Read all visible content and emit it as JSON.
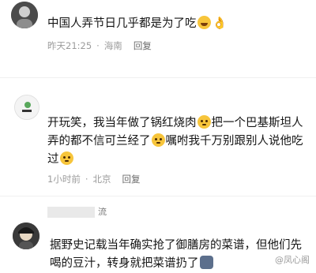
{
  "comments": [
    {
      "text": "中国人弄节日几乎都是为了吃",
      "emojis": [
        "laughing-crying",
        "ok-hand"
      ],
      "time": "昨天21:25",
      "location": "海南",
      "reply_label": "回复"
    },
    {
      "line1": "开玩笑，我当年做了锅红烧肉",
      "line1b": "把一个巴基斯坦人",
      "line2": "弄的都不信可兰经了",
      "line2b": "嘱咐我千万别跟别人说他吃",
      "line3": "过",
      "time": "1小时前",
      "location": "北京",
      "reply_label": "回复"
    },
    {
      "username_suffix": "流",
      "line1": "据野史记载当年确实抢了御膳房的菜谱，但他们先",
      "line2": "喝的豆汁，转身就把菜谱扔了"
    }
  ],
  "watermark": "@凤心阁",
  "colors": {
    "text": "#141414",
    "meta": "#9b9b9b",
    "emoji": "#f7c53b"
  }
}
